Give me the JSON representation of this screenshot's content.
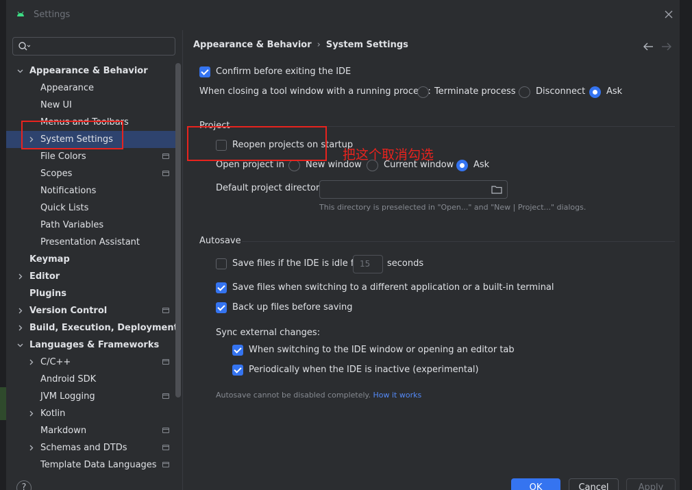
{
  "window": {
    "title": "Settings"
  },
  "sidebar": {
    "search_placeholder": "",
    "items": [
      {
        "label": "Appearance & Behavior",
        "bold": true,
        "chevron": "down"
      },
      {
        "label": "Appearance"
      },
      {
        "label": "New UI"
      },
      {
        "label": "Menus and Toolbars"
      },
      {
        "label": "System Settings",
        "chevron": "right",
        "selected": true
      },
      {
        "label": "File Colors",
        "project": true
      },
      {
        "label": "Scopes",
        "project": true
      },
      {
        "label": "Notifications"
      },
      {
        "label": "Quick Lists"
      },
      {
        "label": "Path Variables"
      },
      {
        "label": "Presentation Assistant"
      },
      {
        "label": "Keymap",
        "bold": true
      },
      {
        "label": "Editor",
        "bold": true,
        "chevron": "right"
      },
      {
        "label": "Plugins",
        "bold": true
      },
      {
        "label": "Version Control",
        "bold": true,
        "chevron": "right",
        "project": true
      },
      {
        "label": "Build, Execution, Deployment",
        "bold": true,
        "chevron": "right"
      },
      {
        "label": "Languages & Frameworks",
        "bold": true,
        "chevron": "down"
      },
      {
        "label": "C/C++",
        "chevron": "right",
        "project": true
      },
      {
        "label": "Android SDK"
      },
      {
        "label": "JVM Logging",
        "project": true
      },
      {
        "label": "Kotlin",
        "chevron": "right"
      },
      {
        "label": "Markdown",
        "project": true
      },
      {
        "label": "Schemas and DTDs",
        "chevron": "right",
        "project": true
      },
      {
        "label": "Template Data Languages",
        "project": true
      }
    ],
    "help_label": "?"
  },
  "breadcrumb": {
    "parent": "Appearance & Behavior",
    "separator": "›",
    "current": "System Settings"
  },
  "general": {
    "confirm_exit": {
      "label": "Confirm before exiting the IDE",
      "checked": true
    },
    "closing_tool_window": {
      "label": "When closing a tool window with a running process:",
      "options": [
        "Terminate process",
        "Disconnect",
        "Ask"
      ],
      "selected": "Ask"
    }
  },
  "project": {
    "section_title": "Project",
    "reopen": {
      "label": "Reopen projects on startup",
      "checked": false
    },
    "open_in": {
      "label": "Open project in",
      "options": [
        "New window",
        "Current window",
        "Ask"
      ],
      "selected": "Ask"
    },
    "default_dir": {
      "label": "Default project directory:",
      "value": "",
      "hint": "This directory is preselected in \"Open...\" and \"New | Project...\" dialogs."
    }
  },
  "autosave": {
    "section_title": "Autosave",
    "idle": {
      "label_before": "Save files if the IDE is idle for",
      "value": "15",
      "label_after": "seconds",
      "checked": false
    },
    "switch_app": {
      "label": "Save files when switching to a different application or a built-in terminal",
      "checked": true
    },
    "backup": {
      "label": "Back up files before saving",
      "checked": true
    },
    "sync_label": "Sync external changes:",
    "sync_switch": {
      "label": "When switching to the IDE window or opening an editor tab",
      "checked": true
    },
    "sync_periodic": {
      "label": "Periodically when the IDE is inactive (experimental)",
      "checked": true
    },
    "note": "Autosave cannot be disabled completely.",
    "note_link": "How it works"
  },
  "annotation": {
    "text": "把这个取消勾选",
    "color": "#e8231e"
  },
  "buttons": {
    "ok": "OK",
    "cancel": "Cancel",
    "apply": "Apply"
  },
  "colors": {
    "accent": "#3574f0",
    "selection": "#2e436e",
    "background": "#2b2d30",
    "annotation": "#e8231e"
  }
}
